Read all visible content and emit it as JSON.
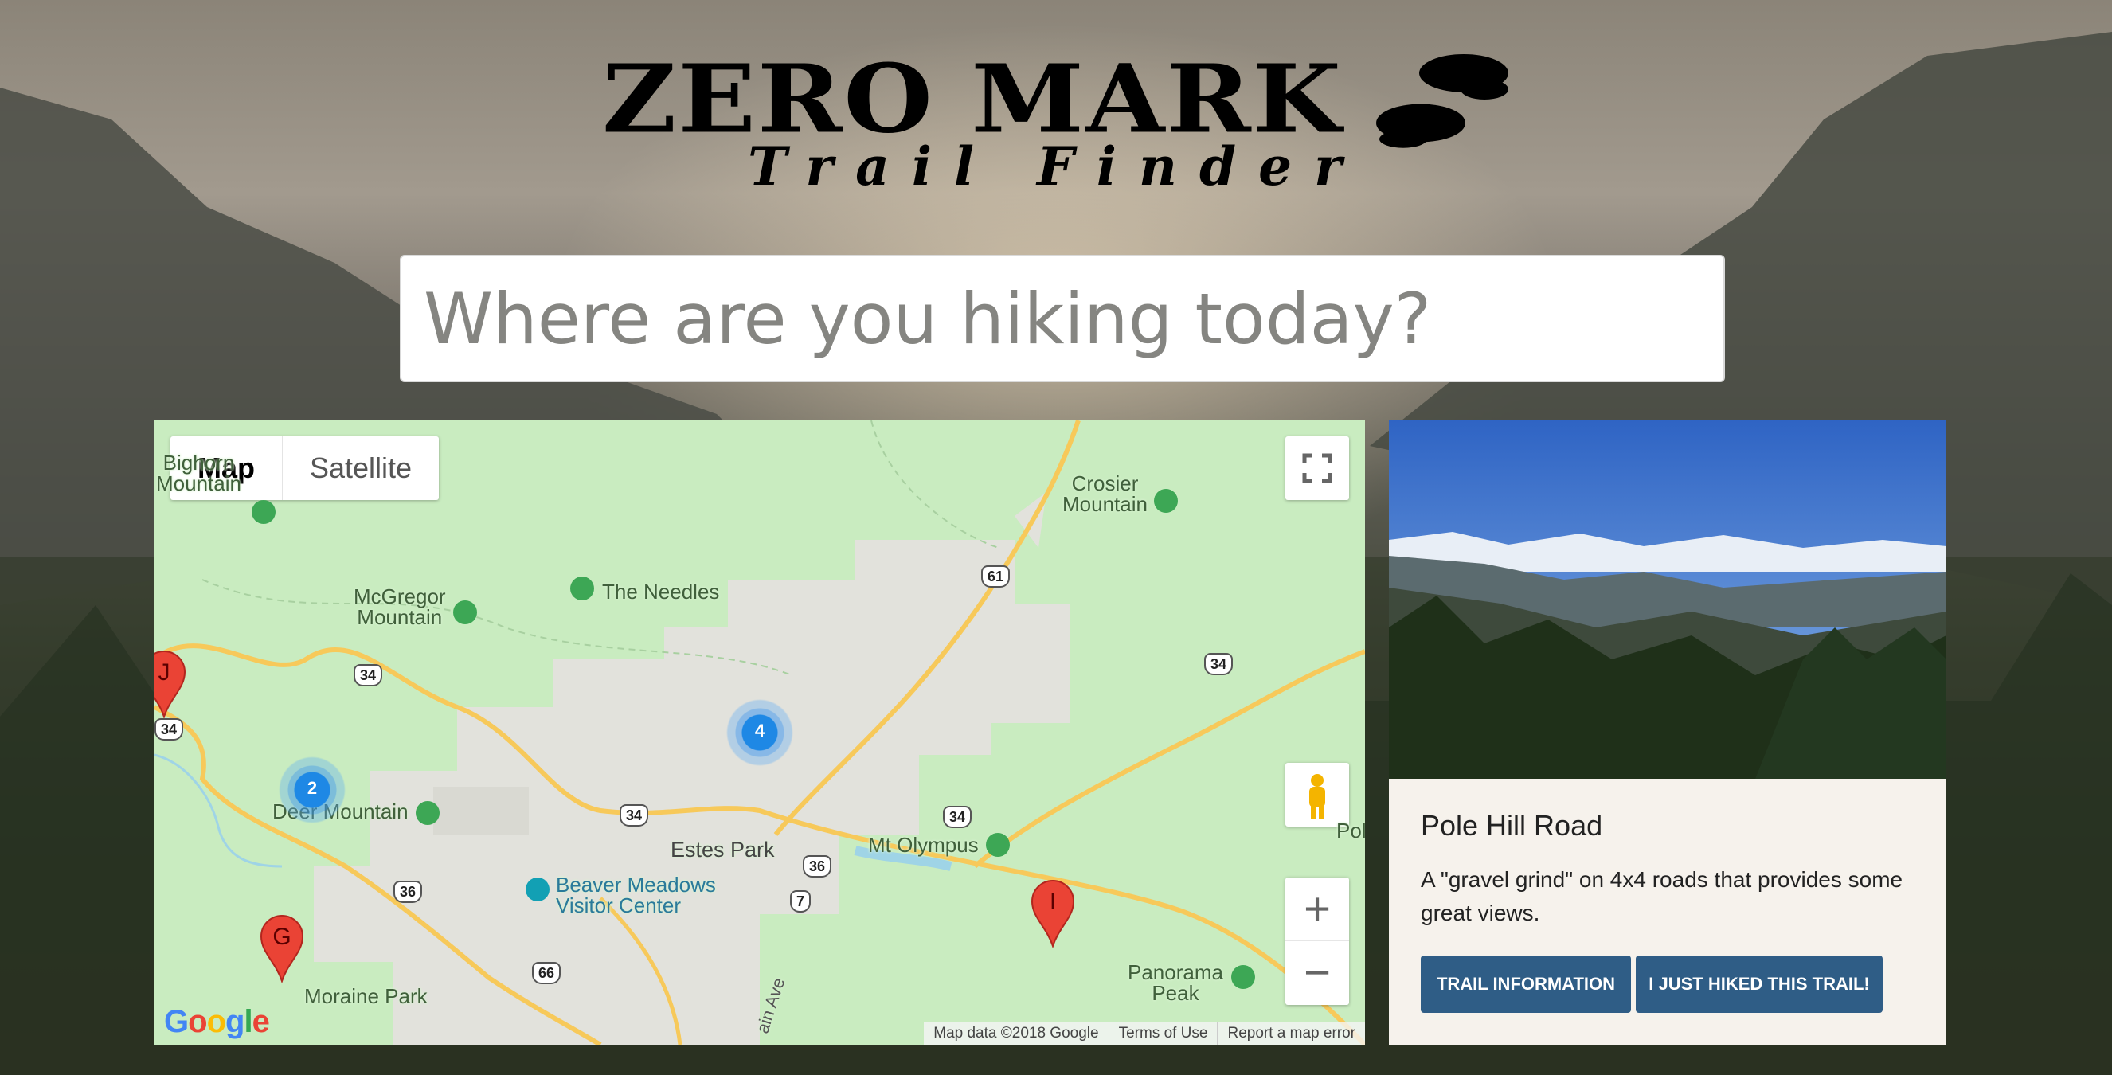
{
  "header": {
    "title": "Zero Mark",
    "subtitle": "Trail Finder",
    "logo_icon": "footprints-icon"
  },
  "search": {
    "placeholder": "Where are you hiking today?"
  },
  "map": {
    "type_controls": [
      "Map",
      "Satellite"
    ],
    "selected_type": "Map",
    "places": {
      "bighorn": "Bighorn\nMountain",
      "crosier": "Crosier\nMountain",
      "mcgregor": "McGregor\nMountain",
      "needles": "The Needles",
      "deer": "Deer Mountain",
      "estes": "Estes Park",
      "olympus": "Mt Olympus",
      "beaver": "Beaver Meadows\nVisitor Center",
      "moraine": "Moraine Park",
      "panorama": "Panorama\nPeak",
      "pol": "Pol",
      "ave": "ain Ave"
    },
    "shields": {
      "r61": "61",
      "r34a": "34",
      "r34b": "34",
      "r34c": "34",
      "r34d": "34",
      "r34e": "34",
      "r36a": "36",
      "r36b": "36",
      "r7": "7",
      "r66": "66"
    },
    "markers": {
      "j": "J",
      "g": "G",
      "i": "I"
    },
    "clusters": {
      "c4": "4",
      "c2": "2"
    },
    "zoom_in": "+",
    "zoom_out": "−",
    "logo": "Google",
    "footer": {
      "data": "Map data ©2018 Google",
      "terms": "Terms of Use",
      "report": "Report a map error"
    },
    "colors": {
      "land": "#c9ecc0",
      "urban": "#e2e2dc",
      "highway": "#f7c95a",
      "water": "#9fd4e6",
      "marker": "#ea4335",
      "cluster": "#1e88e5"
    }
  },
  "trail_card": {
    "title": "Pole Hill Road",
    "description": "A \"gravel grind\" on 4x4 roads that provides some great views.",
    "info_button": "Trail Information",
    "hiked_button": "I just hiked this trail!",
    "button_color": "#2f5d86"
  }
}
